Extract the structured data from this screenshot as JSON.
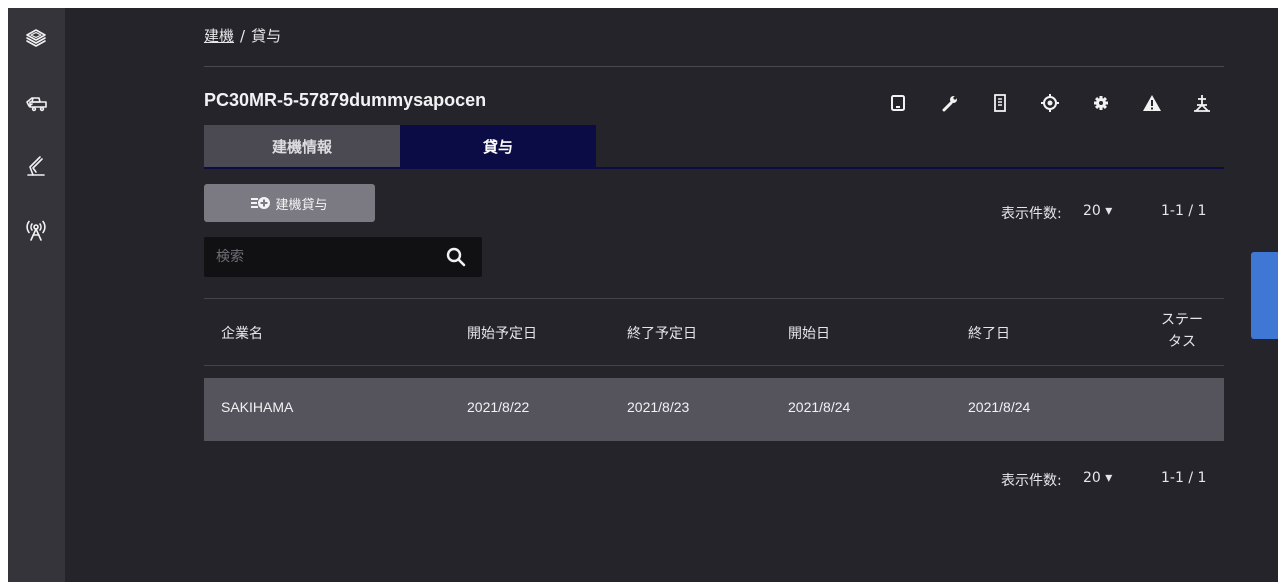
{
  "breadcrumb": {
    "parent": "建機",
    "separator": "/",
    "current": "貸与"
  },
  "machine": {
    "title": "PC30MR-5-57879dummysapocen"
  },
  "tabs": {
    "info": "建機情報",
    "rental": "貸与"
  },
  "actions": {
    "add_rental": "建機貸与"
  },
  "search": {
    "placeholder": "検索"
  },
  "pager_top": {
    "label": "表示件数:",
    "count": "20 ▾",
    "range": "1-1 / 1"
  },
  "pager_bottom": {
    "label": "表示件数:",
    "count": "20 ▾",
    "range": "1-1 / 1"
  },
  "table": {
    "headers": {
      "company": "企業名",
      "planned_start": "開始予定日",
      "planned_end": "終了予定日",
      "start": "開始日",
      "end": "終了日",
      "status_line1": "ステー",
      "status_line2": "タス"
    },
    "rows": [
      {
        "company": "SAKIHAMA",
        "planned_start": "2021/8/22",
        "planned_end": "2021/8/23",
        "start": "2021/8/24",
        "end": "2021/8/24",
        "status": ""
      }
    ]
  },
  "colors": {
    "background": "#25242a",
    "sidebar": "#35343b",
    "active_tab": "#0b0b45",
    "row_highlight": "#55545d",
    "accent": "#3f78d4"
  },
  "icons": {
    "sidebar": [
      "layers-icon",
      "excavator-icon",
      "boom-arm-icon",
      "antenna-icon"
    ],
    "toolbar": [
      "tablet-icon",
      "wrench-icon",
      "document-icon",
      "target-icon",
      "gear-icon",
      "warning-icon",
      "survey-icon"
    ]
  }
}
